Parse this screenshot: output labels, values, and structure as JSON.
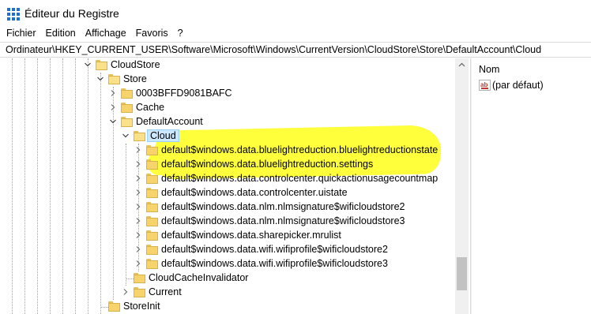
{
  "window": {
    "title": "Éditeur du Registre"
  },
  "menu": [
    "Fichier",
    "Edition",
    "Affichage",
    "Favoris",
    "?"
  ],
  "address": "Ordinateur\\HKEY_CURRENT_USER\\Software\\Microsoft\\Windows\\CurrentVersion\\CloudStore\\Store\\DefaultAccount\\Cloud",
  "tree": {
    "nodes": [
      {
        "label": "CloudStore",
        "expander": "expanded",
        "selected": false
      },
      {
        "label": "Store",
        "expander": "expanded",
        "selected": false
      },
      {
        "label": "0003BFFD9081BAFC",
        "expander": "collapsed",
        "selected": false
      },
      {
        "label": "Cache",
        "expander": "collapsed",
        "selected": false
      },
      {
        "label": "DefaultAccount",
        "expander": "expanded",
        "selected": false
      },
      {
        "label": "Cloud",
        "expander": "expanded",
        "selected": true
      },
      {
        "label": "default$windows.data.bluelightreduction.bluelightreductionstate",
        "expander": "collapsed",
        "selected": false,
        "highlighted": true
      },
      {
        "label": "default$windows.data.bluelightreduction.settings",
        "expander": "collapsed",
        "selected": false,
        "highlighted": true
      },
      {
        "label": "default$windows.data.controlcenter.quickactionusagecountmap",
        "expander": "collapsed",
        "selected": false
      },
      {
        "label": "default$windows.data.controlcenter.uistate",
        "expander": "collapsed",
        "selected": false
      },
      {
        "label": "default$windows.data.nlm.nlmsignature$wificloudstore2",
        "expander": "collapsed",
        "selected": false
      },
      {
        "label": "default$windows.data.nlm.nlmsignature$wificloudstore3",
        "expander": "collapsed",
        "selected": false
      },
      {
        "label": "default$windows.data.sharepicker.mrulist",
        "expander": "collapsed",
        "selected": false
      },
      {
        "label": "default$windows.data.wifi.wifiprofile$wificloudstore2",
        "expander": "collapsed",
        "selected": false
      },
      {
        "label": "default$windows.data.wifi.wifiprofile$wificloudstore3",
        "expander": "collapsed",
        "selected": false
      },
      {
        "label": "CloudCacheInvalidator",
        "expander": "none",
        "selected": false
      },
      {
        "label": "Current",
        "expander": "collapsed",
        "selected": false
      },
      {
        "label": "StoreInit",
        "expander": "none",
        "selected": false
      }
    ]
  },
  "values": {
    "column_name": "Nom",
    "rows": [
      {
        "name": "(par défaut)",
        "icon": "string-value-icon"
      }
    ]
  },
  "colors": {
    "highlight": "#ffff3c",
    "selection": "#cce8ff",
    "folder": "#f6d36b",
    "app_icon": "#1d6fd8"
  }
}
